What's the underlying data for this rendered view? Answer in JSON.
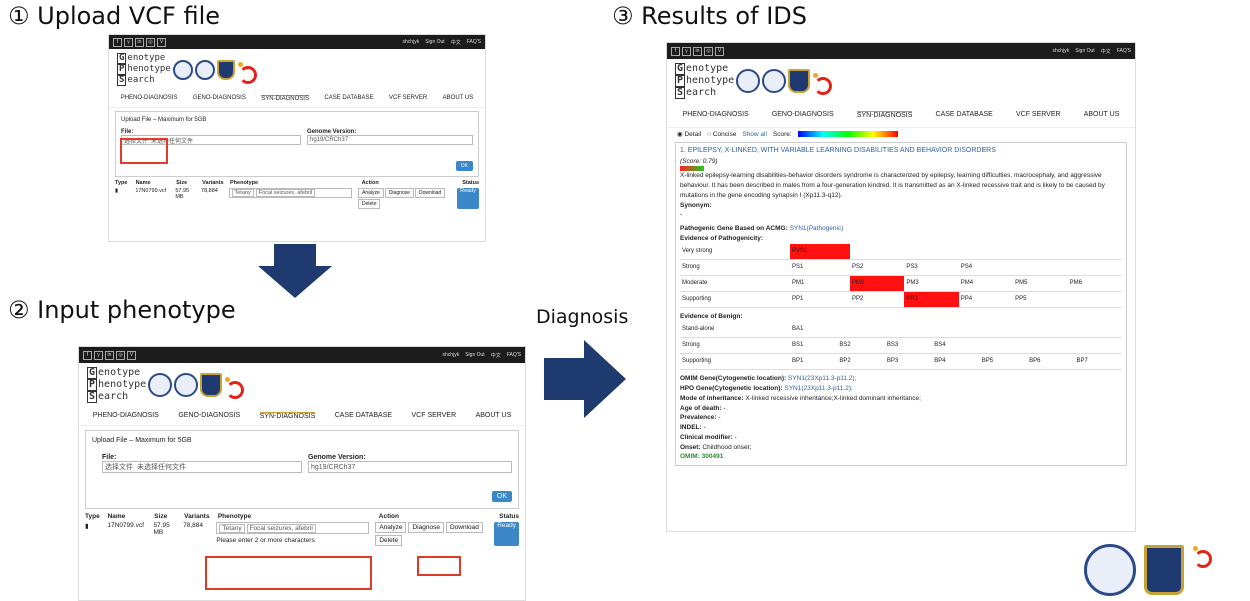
{
  "steps": {
    "s1": "① Upload VCF file",
    "s2": "② Input phenotype",
    "s3": "③ Results of IDS",
    "diagnosis": "Diagnosis"
  },
  "site": {
    "social": [
      "f",
      "𝕪",
      "in",
      "◎",
      "V"
    ],
    "user": "shchjyk",
    "signout": "Sign Out",
    "lang": "中文",
    "faq": "FAQ'S",
    "logo": [
      "enotype",
      "henotype",
      "earch"
    ],
    "logo_letters": [
      "G",
      "P",
      "S"
    ],
    "nav": [
      "PHENO-DIAGNOSIS",
      "GENO-DIAGNOSIS",
      "SYN-DIAGNOSIS",
      "CASE DATABASE",
      "VCF SERVER",
      "ABOUT US"
    ]
  },
  "upload": {
    "title": "Upload File – Maximum for 5GB",
    "file_label": "File:",
    "choose": "选择文件",
    "nofile": "未选择任何文件",
    "genome_label": "Genome Version:",
    "genome": "hg19/CRCh37",
    "ok": "OK",
    "cols": [
      "Type",
      "Name",
      "Size",
      "Variants",
      "Phenotype",
      "Action",
      "Status"
    ],
    "row": {
      "name": "17N0799.vcf",
      "size": "57.95 MB",
      "variants": "78,884",
      "tags": [
        "Tetany",
        "Focal seizures, afebril"
      ],
      "analyze": "Analyze",
      "diagnose": "Diagnose",
      "download": "Download",
      "delete": "Delete",
      "status": "Ready"
    },
    "hint": "Please enter 2 or more characters"
  },
  "results": {
    "detail": "Detail",
    "concise": "Concise",
    "showall": "Show all",
    "score_label": "Score:",
    "title": "1. EPILEPSY, X-LINKED, WITH VARIABLE LEARNING DISABILITIES AND BEHAVIOR DISORDERS",
    "score": "(Score: 0.79)",
    "desc": "X-linked epilepsy-learning disabilities-behavior disorders syndrome is characterized by epilepsy, learning difficulties, macrocephaly, and aggressive behaviour. It has been described in males from a four-generation kindred. It is transmitted as an X-linked recessive trait and is likely to be caused by mutations in the gene encoding synapsin I (Xp11.3-q12).",
    "synonym_label": "Synonym:",
    "synonym": "-",
    "pgb_label": "Pathogenic Gene Based on ACMG:",
    "pgb": "SYN1(Pathogenic)",
    "evp": "Evidence of Pathogenicity:",
    "path_rows": [
      {
        "label": "Very strong",
        "cells": [
          "PVS1"
        ]
      },
      {
        "label": "Strong",
        "cells": [
          "PS1",
          "PS2",
          "PS3",
          "PS4"
        ]
      },
      {
        "label": "Moderate",
        "cells": [
          "PM1",
          "PM2",
          "PM3",
          "PM4",
          "PM5",
          "PM6"
        ]
      },
      {
        "label": "Supporting",
        "cells": [
          "PP1",
          "PP2",
          "PP3",
          "PP4",
          "PP5"
        ]
      }
    ],
    "evb": "Evidence of Benign:",
    "benign_rows": [
      {
        "label": "Stand-alone",
        "cells": [
          "BA1"
        ]
      },
      {
        "label": "Strong",
        "cells": [
          "BS1",
          "BS2",
          "BS3",
          "BS4"
        ]
      },
      {
        "label": "Supporting",
        "cells": [
          "BP1",
          "BP2",
          "BP3",
          "BP4",
          "BP5",
          "BP6",
          "BP7"
        ]
      }
    ],
    "omim_gene_label": "OMIM Gene(Cytogenetic location):",
    "omim_gene": "SYN1(23Xp11.3-p11.2);",
    "hpo_gene_label": "HPO Gene(Cytogenetic location):",
    "hpo_gene": "SYN1(23Xp11.3-p11.2);",
    "moi_label": "Mode of inheritance:",
    "moi": "X-linked recessive inheritance;X-linked dominant inheritance;",
    "aod_label": "Age of death:",
    "aod": "-",
    "prev_label": "Prevalence:",
    "prev": "-",
    "indel_label": "INDEL:",
    "indel": "-",
    "cm_label": "Clinical modifier:",
    "cm": "-",
    "onset_label": "Onset:",
    "onset": "Childhood onset;",
    "omim": "OMIM: 300491"
  }
}
